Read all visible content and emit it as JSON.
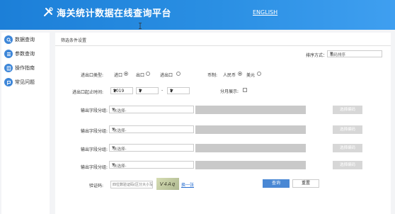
{
  "header": {
    "title": "海关统计数据在线查询平台",
    "lang_link": "ENGLISH"
  },
  "sidebar": {
    "items": [
      {
        "label": "数据查询",
        "icon": "search-icon"
      },
      {
        "label": "参数查询",
        "icon": "list-icon"
      },
      {
        "label": "操作指南",
        "icon": "book-icon"
      },
      {
        "label": "常见问题",
        "icon": "question-icon"
      }
    ]
  },
  "panel": {
    "title": "筛选条件设置",
    "sort": {
      "label": "排序方式：",
      "value": "编码排序"
    },
    "trade_type": {
      "label": "进出口类型:",
      "options": [
        {
          "label": "进口",
          "selected": true
        },
        {
          "label": "出口",
          "selected": false
        },
        {
          "label": "进出口",
          "selected": false
        }
      ]
    },
    "currency": {
      "label": "币制:",
      "options": [
        {
          "label": "人民币",
          "selected": true
        },
        {
          "label": "美元",
          "selected": false
        }
      ]
    },
    "period": {
      "label": "进出口起止时间:",
      "year": "2019",
      "month_from": "2",
      "separator": "-",
      "month_to": "2"
    },
    "monthly": {
      "label": "分月展示:",
      "checked": false
    },
    "output_fields": [
      {
        "label": "输出字段分组:",
        "placeholder": "-未选择-",
        "button": "选择编码"
      },
      {
        "label": "输出字段分组:",
        "placeholder": "-未选择-",
        "button": "选择编码"
      },
      {
        "label": "输出字段分组:",
        "placeholder": "-未选择-",
        "button": "选择编码"
      },
      {
        "label": "输出字段分组:",
        "placeholder": "-未选择-",
        "button": "选择编码"
      }
    ],
    "captcha": {
      "label": "验证码:",
      "placeholder": "四位数验证码(区分大小写)",
      "image_text": "V4Aq",
      "refresh_link": "换一张"
    },
    "actions": {
      "query": "查询",
      "reset": "重置"
    }
  },
  "colors": {
    "header": "#2a8fe3",
    "accent": "#4a88d4",
    "nav_icon": "#3d86d8",
    "disabled": "#c9c9c9"
  }
}
